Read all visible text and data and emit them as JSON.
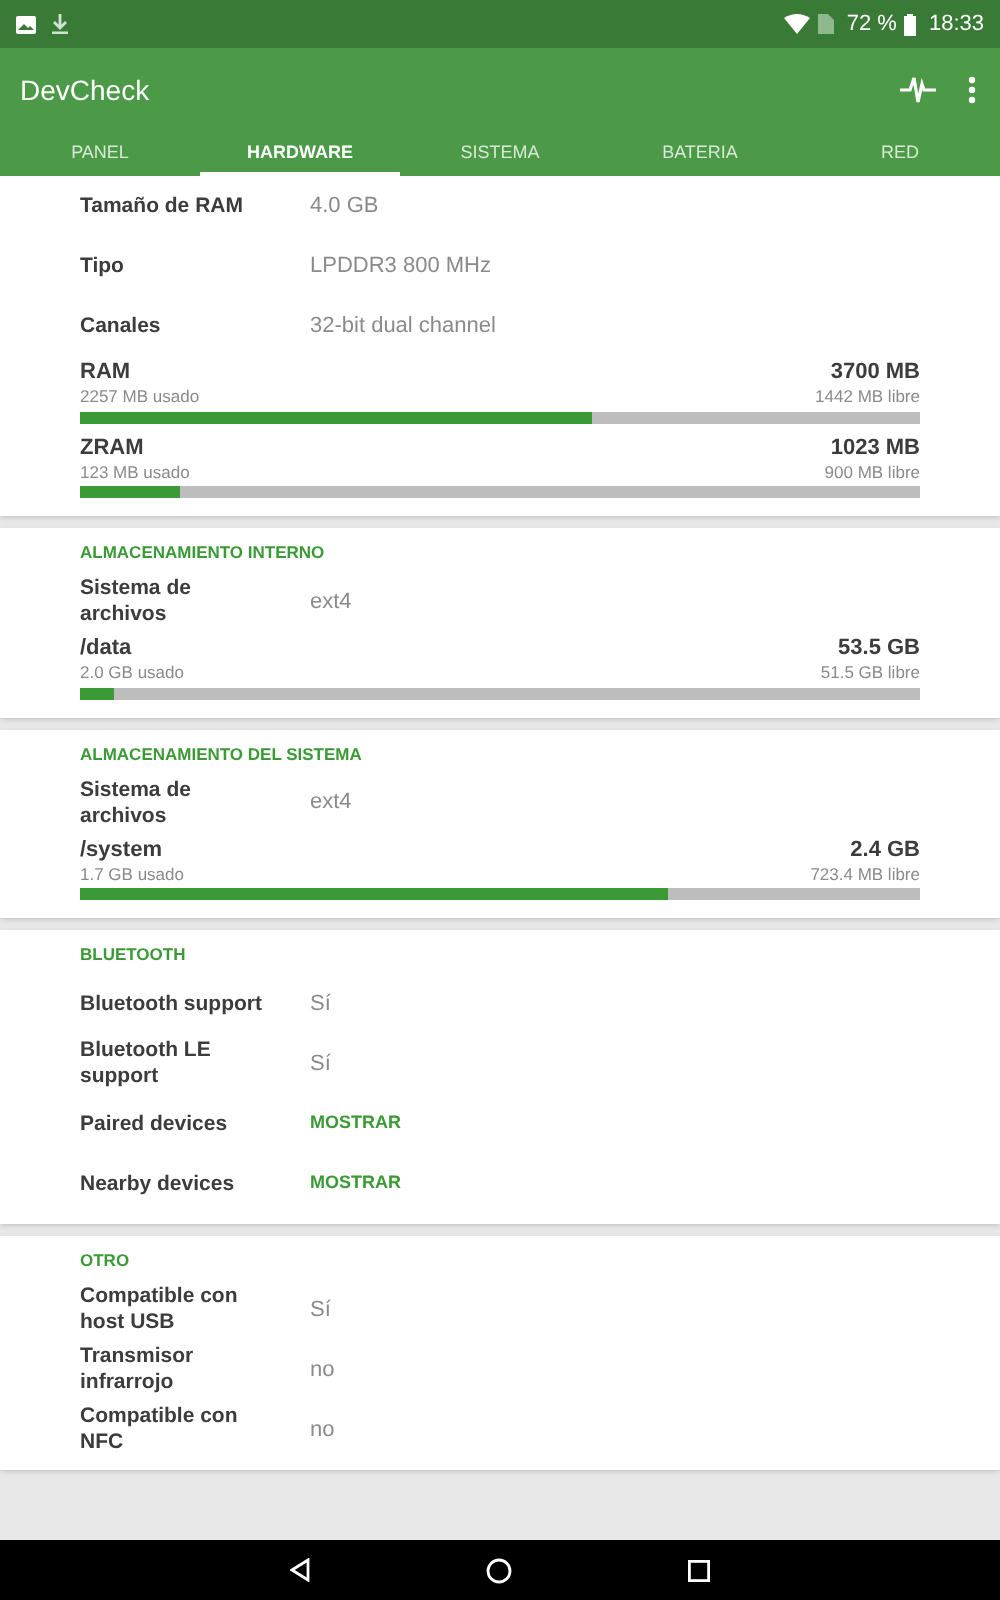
{
  "status_bar": {
    "battery": "72 %",
    "time": "18:33"
  },
  "app_bar": {
    "title": "DevCheck"
  },
  "tabs": [
    {
      "label": "PANEL",
      "selected": false
    },
    {
      "label": "HARDWARE",
      "selected": true
    },
    {
      "label": "SISTEMA",
      "selected": false
    },
    {
      "label": "BATERIA",
      "selected": false
    },
    {
      "label": "RED",
      "selected": false
    }
  ],
  "sections": [
    {
      "items": [
        {
          "kind": "row",
          "label": "Tamaño de RAM",
          "value": "4.0 GB"
        },
        {
          "kind": "row",
          "label": "Tipo",
          "value": "LPDDR3 800 MHz"
        },
        {
          "kind": "row",
          "label": "Canales",
          "value": "32-bit dual channel"
        },
        {
          "kind": "bar",
          "label": "RAM",
          "total": "3700 MB",
          "used": "2257 MB usado",
          "free": "1442 MB libre",
          "level": 0.61
        },
        {
          "kind": "bar",
          "label": "ZRAM",
          "total": "1023 MB",
          "used": "123 MB usado",
          "free": "900 MB libre",
          "level": 0.12
        }
      ]
    },
    {
      "title": "ALMACENAMIENTO INTERNO",
      "items": [
        {
          "kind": "row",
          "label": "Sistema de archivos",
          "value": "ext4"
        },
        {
          "kind": "bar",
          "label": "/data",
          "total": "53.5 GB",
          "used": "2.0 GB usado",
          "free": "51.5 GB libre",
          "level": 0.04
        }
      ]
    },
    {
      "title": "ALMACENAMIENTO DEL SISTEMA",
      "items": [
        {
          "kind": "row",
          "label": "Sistema de archivos",
          "value": "ext4"
        },
        {
          "kind": "bar",
          "label": "/system",
          "total": "2.4 GB",
          "used": "1.7 GB usado",
          "free": "723.4 MB libre",
          "level": 0.7
        }
      ]
    },
    {
      "title": "BLUETOOTH",
      "items": [
        {
          "kind": "row",
          "label": "Bluetooth support",
          "value": "Sí"
        },
        {
          "kind": "row",
          "label": "Bluetooth LE support",
          "value": "Sí"
        },
        {
          "kind": "action",
          "label": "Paired devices",
          "action": "MOSTRAR"
        },
        {
          "kind": "action",
          "label": "Nearby devices",
          "action": "MOSTRAR"
        }
      ]
    },
    {
      "title": "OTRO",
      "items": [
        {
          "kind": "row",
          "label": "Compatible con host USB",
          "value": "Sí"
        },
        {
          "kind": "row",
          "label": "Transmisor infrarrojo",
          "value": "no"
        },
        {
          "kind": "row",
          "label": "Compatible con NFC",
          "value": "no"
        }
      ]
    }
  ]
}
